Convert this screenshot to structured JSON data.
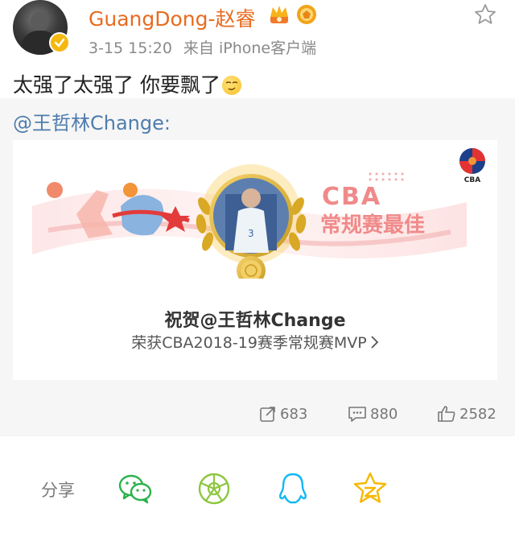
{
  "post": {
    "username": "GuangDong-赵睿",
    "time": "3-15 15:20",
    "source": "来自 iPhone客户端",
    "text": "太强了太强了 你要飘了"
  },
  "retweet": {
    "author": "@王哲林Change:",
    "card": {
      "title": "祝贺@王哲林Change",
      "subtitle": "荣获CBA2018-19赛季常规赛MVP",
      "banner_text_en": "CBA",
      "banner_text_cn": "常规赛最佳",
      "logo_text": "CBA"
    }
  },
  "actions": {
    "reposts": "683",
    "comments": "880",
    "likes": "2582"
  },
  "share": {
    "label": "分享",
    "targets": [
      "wechat-icon",
      "moments-icon",
      "qq-icon",
      "qzone-icon"
    ]
  },
  "colors": {
    "username": "#e86b1f",
    "link": "#4f7cad",
    "banner_accent": "#f08a8a",
    "gold": "#e0b83c"
  }
}
